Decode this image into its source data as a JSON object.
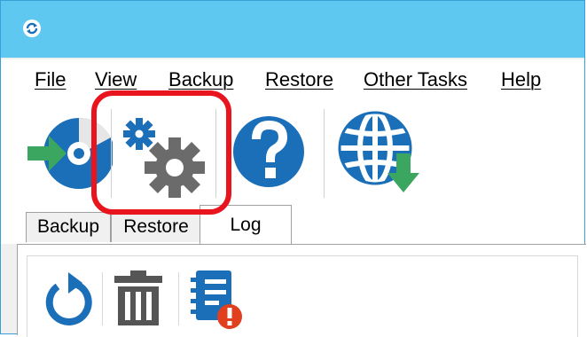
{
  "menu": {
    "items": [
      {
        "key": "F",
        "rest": "ile"
      },
      {
        "key": "V",
        "rest": "iew"
      },
      {
        "key": "B",
        "rest": "ackup"
      },
      {
        "key": "R",
        "rest": "estore"
      },
      {
        "key": "O",
        "rest": "ther Tasks"
      },
      {
        "key": "H",
        "rest": "elp"
      }
    ]
  },
  "toolbar": {
    "icons": [
      "disc-arrow-icon",
      "gears-icon",
      "help-icon",
      "globe-download-icon"
    ]
  },
  "tabs": {
    "backup": "Backup",
    "restore": "Restore",
    "log": "Log",
    "active": "Log"
  },
  "log_toolbar": {
    "icons": [
      "refresh-icon",
      "trash-icon",
      "log-error-icon"
    ]
  },
  "colors": {
    "titlebar": "#5fc8f0",
    "accent_blue": "#1a6fb8",
    "highlight": "#e8141e",
    "gear_gray": "#6b6b6b",
    "green_arrow": "#3aa660"
  }
}
